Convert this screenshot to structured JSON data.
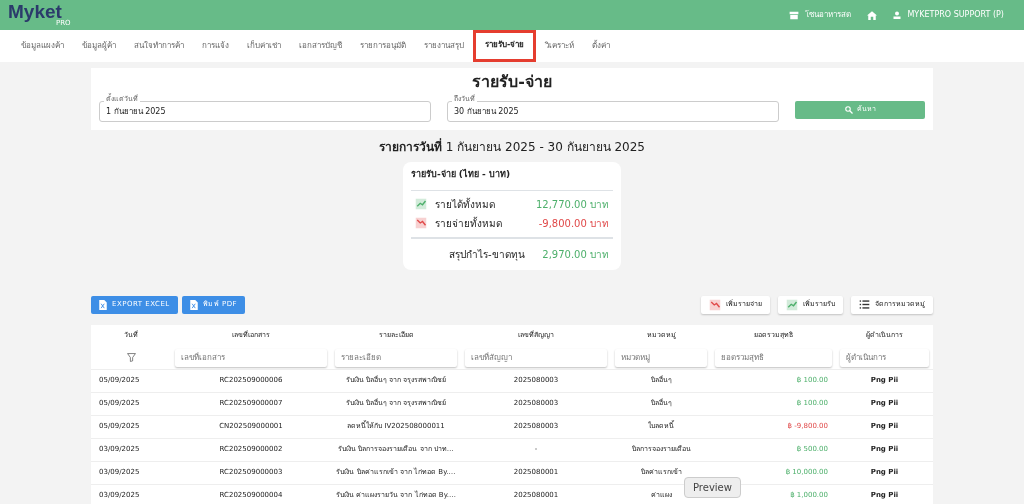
{
  "header": {
    "logo": "Myket",
    "logo_sub": "PRO",
    "store": "โซนอาหารสด",
    "user": "MYKETPRO SUPPORT (P)"
  },
  "tabs": [
    {
      "label": "ข้อมูลแผงค้า",
      "selected": false
    },
    {
      "label": "ข้อมูลผู้ค้า",
      "selected": false
    },
    {
      "label": "สนใจทำการค้า",
      "selected": false
    },
    {
      "label": "การแจ้ง",
      "selected": false
    },
    {
      "label": "เก็บค่าเช่า",
      "selected": false
    },
    {
      "label": "เอกสารบัญชี",
      "selected": false
    },
    {
      "label": "รายการอนุมัติ",
      "selected": false
    },
    {
      "label": "รายงานสรุป",
      "selected": false
    },
    {
      "label": "รายรับ-จ่าย",
      "selected": true
    },
    {
      "label": "วิเคราะห์",
      "selected": false
    },
    {
      "label": "ตั้งค่า",
      "selected": false
    }
  ],
  "page_title": "รายรับ-จ่าย",
  "filters": [
    {
      "label": "ตั้งแต่วันที่",
      "value": "1 กันยายน 2025"
    },
    {
      "label": "ถึงวันที่",
      "value": "30 กันยายน 2025"
    }
  ],
  "search_button": "ค้นหา",
  "range_text": "**รายการวันที่** 1 กันยายน 2025 - 30 กันยายน 2025",
  "summary": {
    "title": "รายรับ-จ่าย (ไทย - บาท)",
    "lines": [
      {
        "kind": "income",
        "label": "รายได้ทั้งหมด",
        "value": "12,770.00 บาท"
      },
      {
        "kind": "expense",
        "label": "รายจ่ายทั้งหมด",
        "value": "-9,800.00 บาท"
      }
    ],
    "total_label": "สรุปกำไร-ขาดทุน",
    "total_value": "2,970.00 บาท"
  },
  "left_buttons": [
    "EXPORT EXCEL",
    "พิมพ์ PDF"
  ],
  "right_buttons": [
    {
      "kind": "expense",
      "label": "เพิ่มรายจ่าย"
    },
    {
      "kind": "income",
      "label": "เพิ่มรายรับ"
    },
    {
      "kind": "list",
      "label": "จัดการหมวดหมู่"
    }
  ],
  "table": {
    "columns": [
      {
        "label": "วันที่"
      },
      {
        "label": "เลขที่เอกสาร",
        "placeholder": "เลขที่เอกสาร"
      },
      {
        "label": "รายละเอียด",
        "placeholder": "รายละเอียด"
      },
      {
        "label": "เลขที่สัญญา",
        "placeholder": "เลขที่สัญญา"
      },
      {
        "label": "หมวดหมู่",
        "placeholder": "หมวดหมู่"
      },
      {
        "label": "ยอดรวมสุทธิ",
        "placeholder": "ยอดรวมสุทธิ"
      },
      {
        "label": "ผู้ดำเนินการ",
        "placeholder": "ผู้ดำเนินการ"
      }
    ],
    "rows": [
      {
        "date": "05/09/2025",
        "doc": "RC202509000006",
        "detail": "รับเงิน บิลอื่นๆ จาก จรุงรสพาณิชย์",
        "contract": "2025080003",
        "category": "บิลอื่นๆ",
        "amount": "฿ 100.00",
        "kind": "income",
        "by": "Png Pii"
      },
      {
        "date": "05/09/2025",
        "doc": "RC202509000007",
        "detail": "รับเงิน บิลอื่นๆ จาก จรุงรสพาณิชย์",
        "contract": "2025080003",
        "category": "บิลอื่นๆ",
        "amount": "฿ 100.00",
        "kind": "income",
        "by": "Png Pii"
      },
      {
        "date": "05/09/2025",
        "doc": "CN202509000001",
        "detail": "ลดหนี้ให้กับ IV202508000011",
        "contract": "2025080003",
        "category": "ใบลดหนี้",
        "amount": "฿ -9,800.00",
        "kind": "expense",
        "by": "Png Pii"
      },
      {
        "date": "03/09/2025",
        "doc": "RC202509000002",
        "detail": "รับเงิน บิลการจองรายเดือน จาก ปาท…",
        "contract": "-",
        "category": "บิลการจองรายเดือน",
        "amount": "฿ 500.00",
        "kind": "income",
        "by": "Png Pii"
      },
      {
        "date": "03/09/2025",
        "doc": "RC202509000003",
        "detail": "รับเงิน บิลค่าแรกเข้า จาก ไก่ทอด By.…",
        "contract": "2025080001",
        "category": "บิลค่าแรกเข้า",
        "amount": "฿ 10,000.00",
        "kind": "income",
        "by": "Png Pii"
      },
      {
        "date": "03/09/2025",
        "doc": "RC202509000004",
        "detail": "รับเงิน ค่าแผงรายวัน จาก ไก่ทอด By.…",
        "contract": "2025080001",
        "category": "ค่าแผง",
        "amount": "฿ 1,000.00",
        "kind": "income",
        "by": "Png Pii"
      }
    ]
  },
  "tooltip": "Preview"
}
